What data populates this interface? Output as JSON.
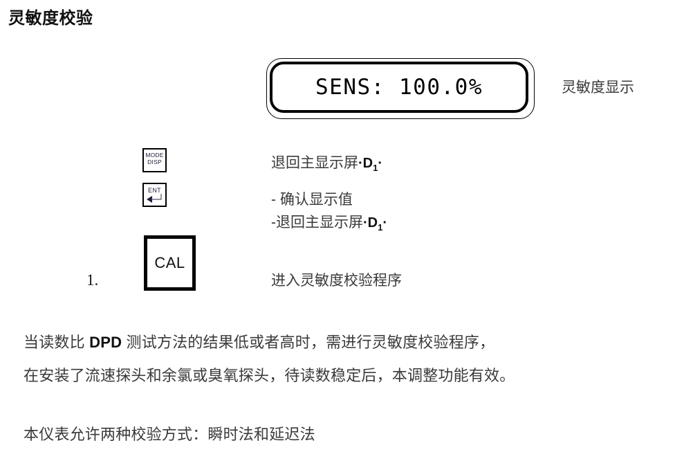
{
  "page": {
    "title": "灵敏度校验"
  },
  "display": {
    "screen_text": "SENS: 100.0%",
    "side_label": "灵敏度显示"
  },
  "keys": {
    "mode_disp": {
      "line1": "MODE",
      "line2": "DISP",
      "icon": "mode-disp-key-icon"
    },
    "ent": {
      "label": "ENT",
      "icon": "enter-arrow-icon"
    },
    "cal": {
      "label": "CAL"
    }
  },
  "steps": {
    "number": "1.",
    "mode_desc": "退回主显示屏",
    "mode_desc_code_prefix": "·",
    "mode_desc_code": "D",
    "mode_desc_code_sub": "1",
    "mode_desc_code_suffix": "·",
    "ent_desc_line1": "- 确认显示值",
    "ent_desc_line2": "-退回主显示屏",
    "ent_desc_line2_code_prefix": "·",
    "ent_desc_line2_code": "D",
    "ent_desc_line2_code_sub": "1",
    "ent_desc_line2_code_suffix": "·",
    "cal_desc": "进入灵敏度校验程序"
  },
  "body": {
    "paragraph1_line1_a": "当读数比 ",
    "paragraph1_line1_b": "DPD",
    "paragraph1_line1_c": " 测试方法的结果低或者高时，需进行灵敏度校验程序，",
    "paragraph1_line2": "在安装了流速探头和余氯或臭氧探头，待读数稳定后，本调整功能有效。",
    "paragraph2": "本仪表允许两种校验方式：瞬时法和延迟法"
  },
  "colors": {
    "ink": "#3a3a3a",
    "black": "#000000",
    "key_text": "#1c1c3a",
    "background": "#ffffff"
  }
}
